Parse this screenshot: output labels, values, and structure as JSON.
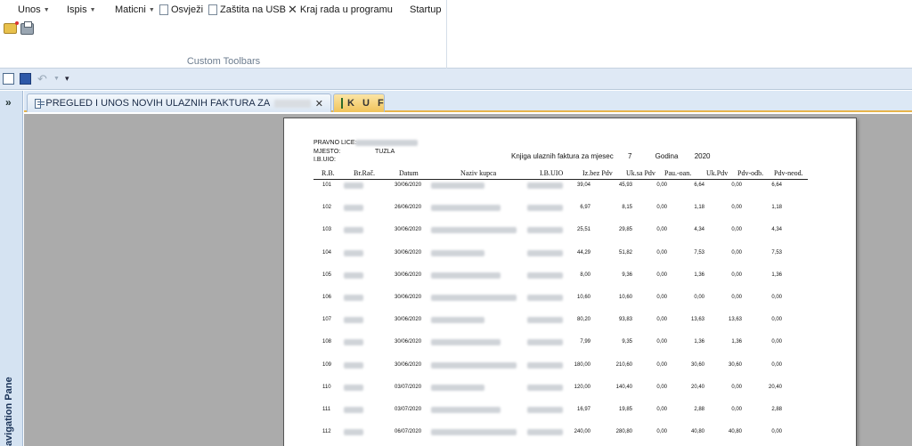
{
  "ribbon": {
    "menu": [
      {
        "label": "Unos",
        "dropdown": true
      },
      {
        "label": "Ispis",
        "dropdown": true
      },
      {
        "label": "Maticni",
        "dropdown": true
      },
      {
        "label": "Osvježi",
        "icon": "document-icon"
      },
      {
        "label": "Zaštita na USB",
        "icon": "document-icon"
      },
      {
        "label": "Kraj rada u programu",
        "icon": "close-x-icon"
      },
      {
        "label": "Startup",
        "dropdown": false
      }
    ],
    "group_label": "Custom Toolbars"
  },
  "tabs": [
    {
      "label": "PREGLED I UNOS NOVIH ULAZNIH FAKTURA ZA",
      "icon": "form-icon",
      "active": false
    },
    {
      "label": "K U F",
      "icon": "report-icon",
      "active": true
    }
  ],
  "navigation_pane": {
    "label": "Navigation Pane"
  },
  "report": {
    "header": {
      "pravno_lice_label": "PRAVNO LICE:",
      "mjesto_label": "MJESTO:",
      "mjesto_value": "TUZLA",
      "ibuio_label": "I.B.UIO:",
      "title": "Knjiga ulaznih faktura za mjesec",
      "month": "7",
      "year_label": "Godina",
      "year": "2020"
    },
    "columns": [
      "R.B.",
      "Br.Rač.",
      "Datum",
      "Naziv kupca",
      "I.B.UIO",
      "Iz.bez Pdv",
      "Uk.sa Pdv",
      "Pau.-oan.",
      "Uk.Pdv",
      "Pdv-odb.",
      "Pdv-neod."
    ],
    "rows": [
      {
        "rb": "101",
        "datum": "30/06/2020",
        "bez_pdv": "39,04",
        "sa_pdv": "45,93",
        "pau": "0,00",
        "uk_pdv": "6,64",
        "odb": "0,00",
        "neod": "6,64"
      },
      {
        "rb": "102",
        "datum": "26/06/2020",
        "bez_pdv": "6,97",
        "sa_pdv": "8,15",
        "pau": "0,00",
        "uk_pdv": "1,18",
        "odb": "0,00",
        "neod": "1,18"
      },
      {
        "rb": "103",
        "datum": "30/06/2020",
        "bez_pdv": "25,51",
        "sa_pdv": "29,85",
        "pau": "0,00",
        "uk_pdv": "4,34",
        "odb": "0,00",
        "neod": "4,34"
      },
      {
        "rb": "104",
        "datum": "30/06/2020",
        "bez_pdv": "44,29",
        "sa_pdv": "51,82",
        "pau": "0,00",
        "uk_pdv": "7,53",
        "odb": "0,00",
        "neod": "7,53"
      },
      {
        "rb": "105",
        "datum": "30/06/2020",
        "bez_pdv": "8,00",
        "sa_pdv": "9,36",
        "pau": "0,00",
        "uk_pdv": "1,36",
        "odb": "0,00",
        "neod": "1,36"
      },
      {
        "rb": "106",
        "datum": "30/06/2020",
        "bez_pdv": "10,60",
        "sa_pdv": "10,60",
        "pau": "0,00",
        "uk_pdv": "0,00",
        "odb": "0,00",
        "neod": "0,00"
      },
      {
        "rb": "107",
        "datum": "30/06/2020",
        "bez_pdv": "80,20",
        "sa_pdv": "93,83",
        "pau": "0,00",
        "uk_pdv": "13,63",
        "odb": "13,63",
        "neod": "0,00"
      },
      {
        "rb": "108",
        "datum": "30/06/2020",
        "bez_pdv": "7,99",
        "sa_pdv": "9,35",
        "pau": "0,00",
        "uk_pdv": "1,36",
        "odb": "1,36",
        "neod": "0,00"
      },
      {
        "rb": "109",
        "datum": "30/06/2020",
        "bez_pdv": "180,00",
        "sa_pdv": "210,60",
        "pau": "0,00",
        "uk_pdv": "30,60",
        "odb": "30,60",
        "neod": "0,00"
      },
      {
        "rb": "110",
        "datum": "03/07/2020",
        "bez_pdv": "120,00",
        "sa_pdv": "140,40",
        "pau": "0,00",
        "uk_pdv": "20,40",
        "odb": "0,00",
        "neod": "20,40"
      },
      {
        "rb": "111",
        "datum": "03/07/2020",
        "bez_pdv": "16,97",
        "sa_pdv": "19,85",
        "pau": "0,00",
        "uk_pdv": "2,88",
        "odb": "0,00",
        "neod": "2,88"
      },
      {
        "rb": "112",
        "datum": "06/07/2020",
        "bez_pdv": "240,00",
        "sa_pdv": "280,80",
        "pau": "0,00",
        "uk_pdv": "40,80",
        "odb": "40,80",
        "neod": "0,00"
      }
    ]
  }
}
